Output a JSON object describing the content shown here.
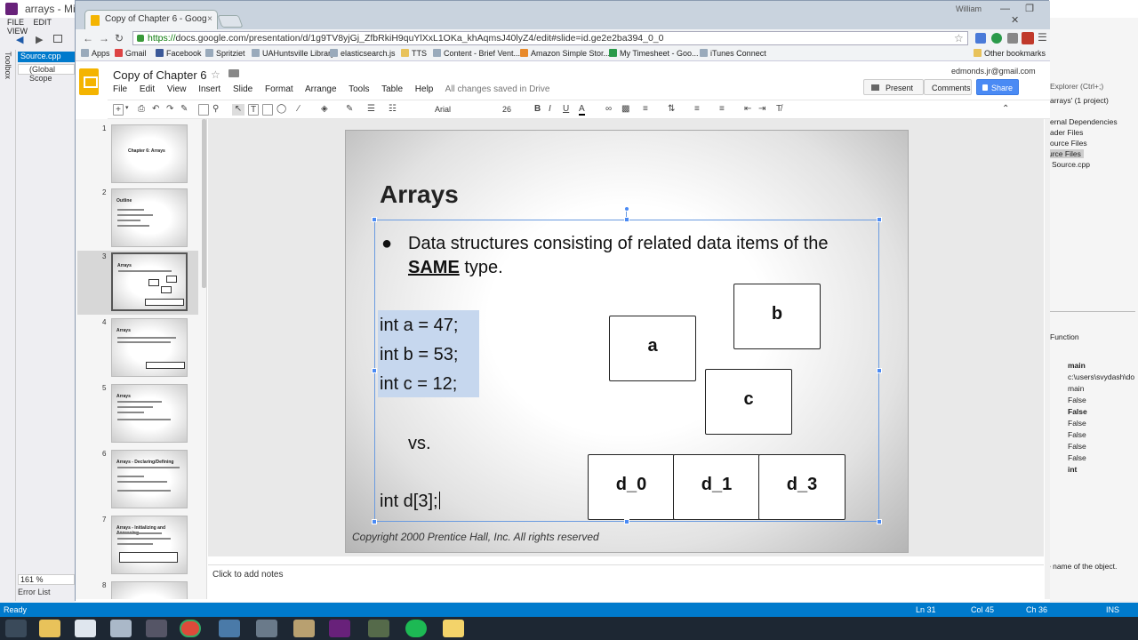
{
  "vs": {
    "title": "arrays - Mic",
    "menu": [
      "FILE",
      "EDIT",
      "VIEW"
    ],
    "toolbox_label": "Toolbox",
    "tab_label": "Source.cpp",
    "scope_label": "(Global Scope",
    "zoom": "161 %",
    "error_list": "Error List",
    "status": {
      "ready": "Ready",
      "ln": "Ln 31",
      "col": "Col 45",
      "ch": "Ch 36",
      "ins": "INS"
    },
    "right_panel": {
      "search": "Explorer (Ctrl+;)",
      "solution": "arrays' (1 project)",
      "items": [
        "ernal Dependencies",
        "ader Files",
        "ource Files",
        "urce Files",
        "Source.cpp"
      ],
      "section": "Function",
      "props": [
        "main",
        "c:\\users\\svydash\\do",
        "main",
        "False",
        "False",
        "False",
        "False",
        "False",
        "False",
        "int"
      ],
      "desc": "e name of the object."
    }
  },
  "chrome": {
    "tab_title": "Copy of Chapter 6 - Goog",
    "user": "William",
    "url_scheme": "https://",
    "url_rest": "docs.google.com/presentation/d/1g9TV8yjGj_ZfbRkiH9quYlXxL1OKa_khAqmsJ40lyZ4/edit#slide=id.ge2e2ba394_0_0",
    "bookmarks": [
      "Apps",
      "Gmail",
      "Facebook",
      "Spritziet",
      "UAHuntsville Library",
      "elasticsearch.js",
      "TTS",
      "Content - Brief Vent...",
      "Amazon Simple Stor...",
      "My Timesheet - Goo...",
      "iTunes Connect"
    ],
    "other_bookmarks": "Other bookmarks"
  },
  "slides": {
    "doc_title": "Copy of Chapter 6",
    "menu": [
      "File",
      "Edit",
      "View",
      "Insert",
      "Slide",
      "Format",
      "Arrange",
      "Tools",
      "Table",
      "Help"
    ],
    "saved_status": "All changes saved in Drive",
    "account": "edmonds.jr@gmail.com",
    "present": "Present",
    "comments": "Comments",
    "share": "Share",
    "font_name": "Arial",
    "font_size": "26",
    "notes_placeholder": "Click to add notes",
    "thumbnails": [
      {
        "num": "1",
        "title": "Chapter 6: Arrays"
      },
      {
        "num": "2",
        "title": "Outline"
      },
      {
        "num": "3",
        "title": "Arrays"
      },
      {
        "num": "4",
        "title": "Arrays"
      },
      {
        "num": "5",
        "title": "Arrays"
      },
      {
        "num": "6",
        "title": "Arrays - Declaring/Defining"
      },
      {
        "num": "7",
        "title": "Arrays - Initializing and Accessing"
      },
      {
        "num": "8",
        "title": ""
      }
    ]
  },
  "slide": {
    "title": "Arrays",
    "bullet_pre": "Data structures consisting of related data items of the ",
    "bullet_bold": "SAME",
    "bullet_post": " type.",
    "code_lines": [
      "int a = 47;",
      "int b = 53;",
      "int c = 12;"
    ],
    "vs": "vs.",
    "array_decl": "int d[3];",
    "boxes": [
      "a",
      "b",
      "c",
      "d_0",
      "d_1",
      "d_3"
    ],
    "copyright": "Copyright 2000 Prentice Hall, Inc. All rights reserved"
  }
}
